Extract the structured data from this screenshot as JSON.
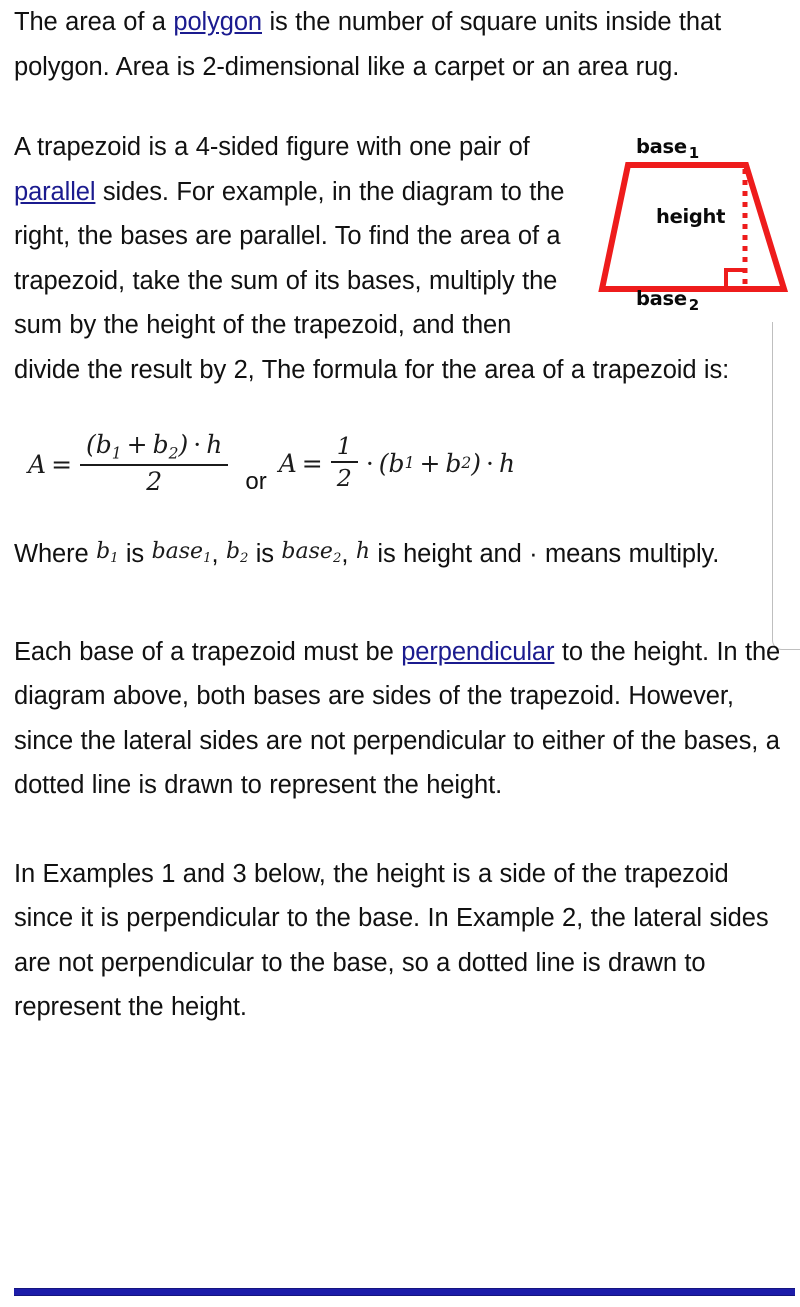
{
  "document": {
    "paragraphs": {
      "p1_a": "The area of a ",
      "p1_link": "polygon",
      "p1_b": " is the number of square units inside that polygon. Area is 2-dimensional like a carpet or an area rug.",
      "p2_a": "A trapezoid is a 4-sided figure with one pair of ",
      "p2_link": "parallel",
      "p2_b": " sides. For example, in the diagram to the right, the bases are parallel. To find the area of a trapezoid, take the sum of its bases, multiply the sum by the height of the trapezoid, and then divide the result by 2, The formula for the area of a trapezoid is:",
      "p3_where": "Where ",
      "p3_is1": " is ",
      "p3_comma1": ", ",
      "p3_is2": " is ",
      "p3_comma2": ", ",
      "p3_tail": " is height and · means multiply.",
      "p4_a": "Each base of a trapezoid must be ",
      "p4_link": "perpendicular",
      "p4_b": " to the height. In the diagram above, both bases are sides of the trapezoid. However, since the lateral sides are not perpendicular to either of the bases, a dotted line is drawn to represent the height.",
      "p5": "In Examples 1 and 3 below, the height is a side of the trapezoid since it is perpendicular to the base. In Example 2, the lateral sides are not perpendicular to the base, so a dotted line is drawn to represent the height."
    },
    "figure": {
      "name": "trapezoid-diagram",
      "label_base1": "base",
      "label_base1_sub": "1",
      "label_base2": "base",
      "label_base2_sub": "2",
      "label_height": "height",
      "stroke_color": "#ee1c1c",
      "dotted_color": "#ee1c1c"
    },
    "formula": {
      "A": "A",
      "equals": "=",
      "open_paren": "(",
      "b": "b",
      "sub1": "1",
      "sub2": "2",
      "plus": "+",
      "close_paren": ")",
      "dot": "·",
      "h": "h",
      "two": "2",
      "one": "1",
      "or": "or"
    },
    "inline_math": {
      "b1_var": "b",
      "b1_sub": "1",
      "b2_var": "b",
      "b2_sub": "2",
      "base1_word": "base",
      "base1_sub": "1",
      "base2_word": "base",
      "base2_sub": "2",
      "h_var": "h"
    },
    "colors": {
      "link": "#1b1b8f",
      "figure_red": "#ee1c1c",
      "rule_blue": "#1c1caa",
      "text": "#111111"
    }
  }
}
